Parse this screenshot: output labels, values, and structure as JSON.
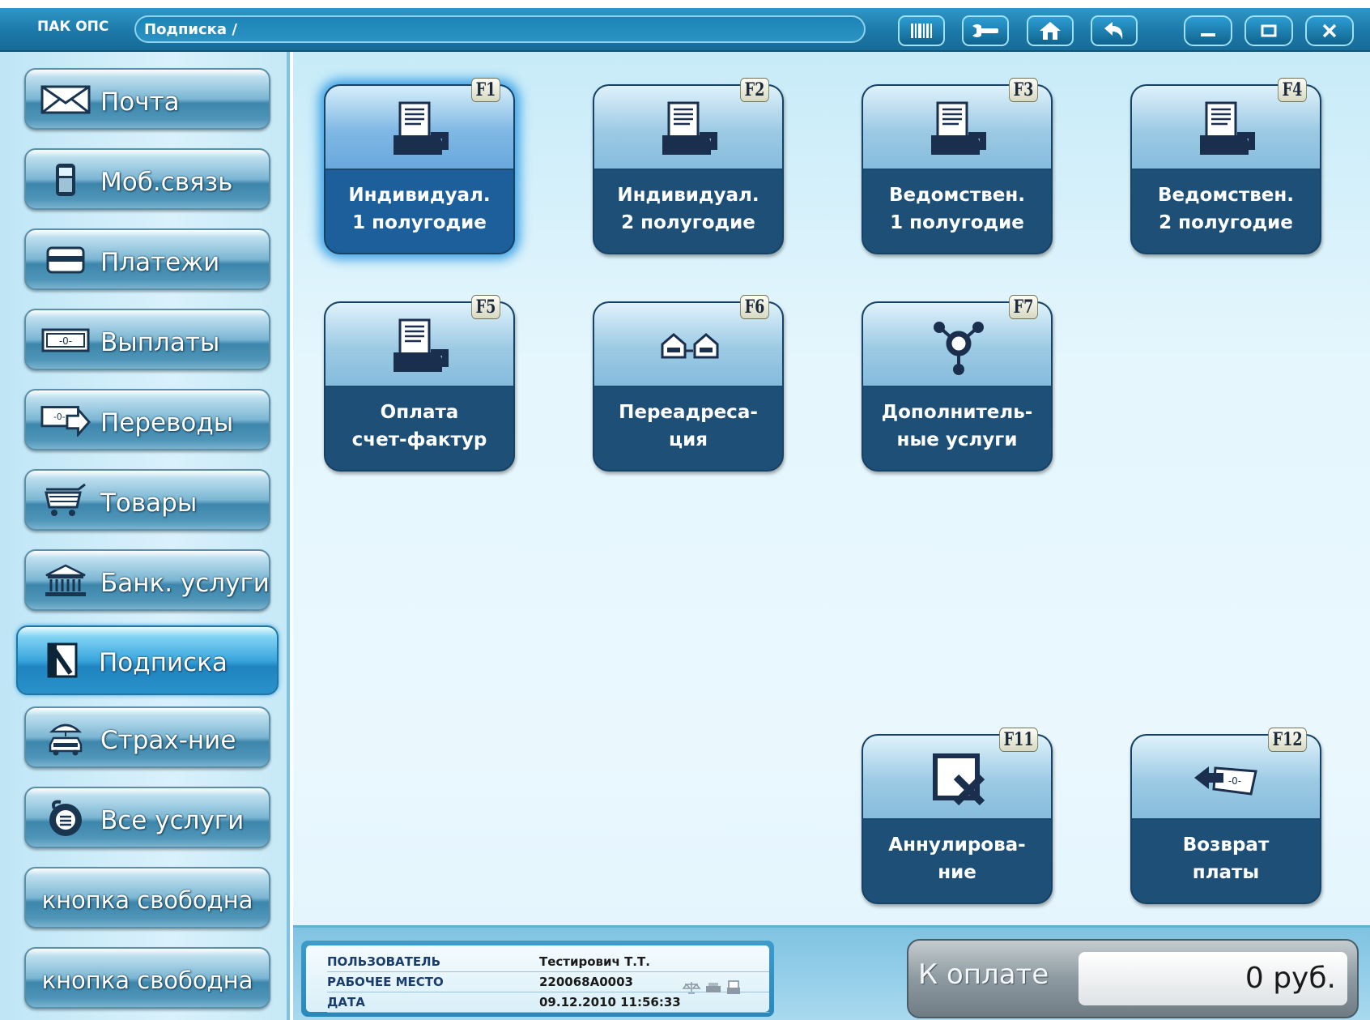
{
  "titlebar": {
    "app_name": "ПАК ОПС",
    "path": "Подписка /",
    "buttons": [
      {
        "name": "barcode-icon"
      },
      {
        "name": "wrench-icon"
      },
      {
        "name": "home-icon"
      },
      {
        "name": "back-arrow-icon"
      },
      {
        "name": "minimize-icon"
      },
      {
        "name": "maximize-icon"
      },
      {
        "name": "close-icon"
      }
    ]
  },
  "sidebar": {
    "active_item": "Подписка",
    "items": [
      {
        "label": "Почта",
        "icon": "envelope-icon"
      },
      {
        "label": "Моб.связь",
        "icon": "mobile-phone-icon"
      },
      {
        "label": "Платежи",
        "icon": "card-icon"
      },
      {
        "label": "Выплаты",
        "icon": "banknote-icon"
      },
      {
        "label": "Переводы",
        "icon": "transfer-icon"
      },
      {
        "label": "Товары",
        "icon": "cart-icon"
      },
      {
        "label": "Банк. услуги",
        "icon": "bank-icon"
      },
      {
        "label": "Подписка",
        "icon": "subscription-icon"
      },
      {
        "label": "Страх-ние",
        "icon": "insurance-icon"
      },
      {
        "label": "Все услуги",
        "icon": "all-services-icon"
      },
      {
        "label": "кнопка свободна"
      },
      {
        "label": "кнопка свободна"
      }
    ]
  },
  "tiles": [
    {
      "fkey": "F1",
      "label": "Индивидуал.\n1 полугодие",
      "icon": "document-hand-icon",
      "active": true
    },
    {
      "fkey": "F2",
      "label": "Индивидуал.\n2 полугодие",
      "icon": "document-hand-icon"
    },
    {
      "fkey": "F3",
      "label": "Ведомствен.\n1 полугодие",
      "icon": "document-hand-icon"
    },
    {
      "fkey": "F4",
      "label": "Ведомствен.\n2 полугодие",
      "icon": "document-hand-icon"
    },
    {
      "fkey": "F5",
      "label": "Оплата\nсчет-фактур",
      "icon": "document-hand-icon"
    },
    {
      "fkey": "F6",
      "label": "Переадреса-\nция",
      "icon": "redirect-houses-icon"
    },
    {
      "fkey": "F7",
      "label": "Дополнитель-\nные услуги",
      "icon": "additional-services-icon"
    },
    {
      "fkey": "F11",
      "label": "Аннулирова-\nние",
      "icon": "cancel-icon"
    },
    {
      "fkey": "F12",
      "label": "Возврат\nплаты",
      "icon": "refund-icon"
    }
  ],
  "status": {
    "user_label": "ПОЛЬЗОВАТЕЛЬ",
    "user_value": "Тестирович Т.Т.",
    "workplace_label": "РАБОЧЕЕ МЕСТО",
    "workplace_value": "220068A0003",
    "date_label": "ДАТА",
    "date_value": "09.12.2010  11:56:33",
    "device_icons": [
      "scales-icon",
      "printer-icon",
      "receipt-printer-icon"
    ]
  },
  "payment": {
    "label": "К оплате",
    "amount": "0 руб."
  },
  "colors": {
    "titlebar": "#1c79a9",
    "tile_dark": "#1d4f77",
    "tile_glow": "#3aa1e6",
    "sidebar_bg": "#d9f1fb"
  }
}
